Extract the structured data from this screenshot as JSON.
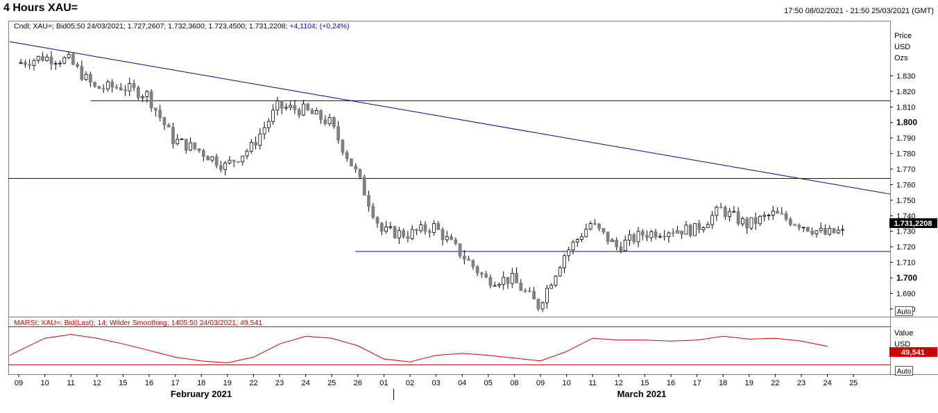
{
  "header": {
    "title": "4 Hours XAU=",
    "range": "17:50 08/02/2021 - 21:50 25/03/2021 (GMT)"
  },
  "price_panel": {
    "legend_prefix": "Cndl; XAU=; Bid05:50 24/03/2021; 1.727,2607; 1.732,3600; 1.723,4500; 1.731,2208; ",
    "legend_change": "+4,1104; (+0,24%)",
    "axis_title": [
      "Price",
      "USD",
      "Ozs"
    ],
    "last_price": "1.731,2208",
    "auto_label": "Auto"
  },
  "rsi_panel": {
    "legend": "MARSI; XAU=; Bid(Last);  14; Wilder Smoothing; 1405:50 24/03/2021; 49,541",
    "axis_title": [
      "Value",
      "USD",
      "Ozs"
    ],
    "last_value": "49,541",
    "auto_label": "Auto"
  },
  "colors": {
    "up_candle": "#ffffff",
    "down_candle": "#808080",
    "trend_line": "#00008b",
    "rsi_line": "#cc0000",
    "rsi_band": "#cc0000",
    "last_price_bg": "#000000",
    "last_rsi_bg": "#cc0000",
    "change_text": "#0000cc"
  },
  "chart_data": [
    {
      "type": "candlestick",
      "title": "4 Hours XAU=",
      "ylabel": "Price USD Ozs",
      "ylim": [
        1.675,
        1.865
      ],
      "yticks": [
        "1.680",
        "1.690",
        "1.700",
        "1.710",
        "1.720",
        "1.730",
        "1.740",
        "1.750",
        "1.760",
        "1.770",
        "1.780",
        "1.790",
        "1.800",
        "1.810",
        "1.820",
        "1.830"
      ],
      "ytick_values": [
        1.68,
        1.69,
        1.7,
        1.71,
        1.72,
        1.73,
        1.74,
        1.75,
        1.76,
        1.77,
        1.78,
        1.79,
        1.8,
        1.81,
        1.82,
        1.83
      ],
      "ytick_bold": [
        "1.700",
        "1.800"
      ],
      "xticks": [
        "09",
        "10",
        "11",
        "12",
        "15",
        "16",
        "17",
        "18",
        "19",
        "22",
        "23",
        "24",
        "25",
        "26",
        "01",
        "02",
        "03",
        "04",
        "05",
        "08",
        "09",
        "10",
        "11",
        "12",
        "15",
        "16",
        "17",
        "18",
        "19",
        "22",
        "23",
        "24",
        "25"
      ],
      "months": [
        "February 2021",
        "March 2021"
      ],
      "x_start": "09",
      "session_anchors": [
        {
          "label": "09",
          "price": 1.838
        },
        {
          "label": "10",
          "price": 1.842
        },
        {
          "label": "11",
          "price": 1.84
        },
        {
          "label": "12",
          "price": 1.822
        },
        {
          "label": "15",
          "price": 1.823
        },
        {
          "label": "16",
          "price": 1.818
        },
        {
          "label": "17",
          "price": 1.789
        },
        {
          "label": "18",
          "price": 1.782
        },
        {
          "label": "19",
          "price": 1.772
        },
        {
          "label": "22",
          "price": 1.784
        },
        {
          "label": "23",
          "price": 1.81
        },
        {
          "label": "24",
          "price": 1.808
        },
        {
          "label": "25",
          "price": 1.8
        },
        {
          "label": "26",
          "price": 1.768
        },
        {
          "label": "01",
          "price": 1.73
        },
        {
          "label": "02",
          "price": 1.728
        },
        {
          "label": "03",
          "price": 1.733
        },
        {
          "label": "04",
          "price": 1.716
        },
        {
          "label": "05",
          "price": 1.699
        },
        {
          "label": "08",
          "price": 1.699
        },
        {
          "label": "09",
          "price": 1.682
        },
        {
          "label": "10",
          "price": 1.715
        },
        {
          "label": "11",
          "price": 1.735
        },
        {
          "label": "12",
          "price": 1.72
        },
        {
          "label": "15",
          "price": 1.728
        },
        {
          "label": "16",
          "price": 1.731
        },
        {
          "label": "17",
          "price": 1.731
        },
        {
          "label": "18",
          "price": 1.744
        },
        {
          "label": "19",
          "price": 1.734
        },
        {
          "label": "22",
          "price": 1.741
        },
        {
          "label": "23",
          "price": 1.735
        },
        {
          "label": "24",
          "price": 1.728
        }
      ],
      "last_close": 1.7312,
      "horizontal_lines": [
        1.814,
        1.764,
        1.717
      ],
      "trend_line": {
        "from": {
          "x": "09",
          "price": 1.851
        },
        "to": {
          "x": "25",
          "price": 1.758
        }
      }
    },
    {
      "type": "line",
      "title": "MARSI; XAU=; Bid(Last);  14; Wilder Smoothing",
      "ylabel": "Value USD Ozs",
      "ylim": [
        20,
        80
      ],
      "bands": [
        70,
        30
      ],
      "series": [
        {
          "name": "MARSI",
          "x": [
            "09",
            "10",
            "11",
            "12",
            "15",
            "16",
            "17",
            "18",
            "19",
            "22",
            "23",
            "24",
            "25",
            "26",
            "01",
            "02",
            "03",
            "04",
            "05",
            "08",
            "09",
            "10",
            "11",
            "12",
            "15",
            "16",
            "17",
            "18",
            "19",
            "22",
            "23",
            "24"
          ],
          "values": [
            40,
            58,
            62,
            58,
            52,
            45,
            38,
            34,
            32,
            38,
            52,
            60,
            58,
            50,
            36,
            33,
            40,
            42,
            40,
            37,
            34,
            44,
            58,
            56,
            56,
            55,
            56,
            60,
            57,
            58,
            55,
            49.5
          ]
        }
      ]
    }
  ]
}
